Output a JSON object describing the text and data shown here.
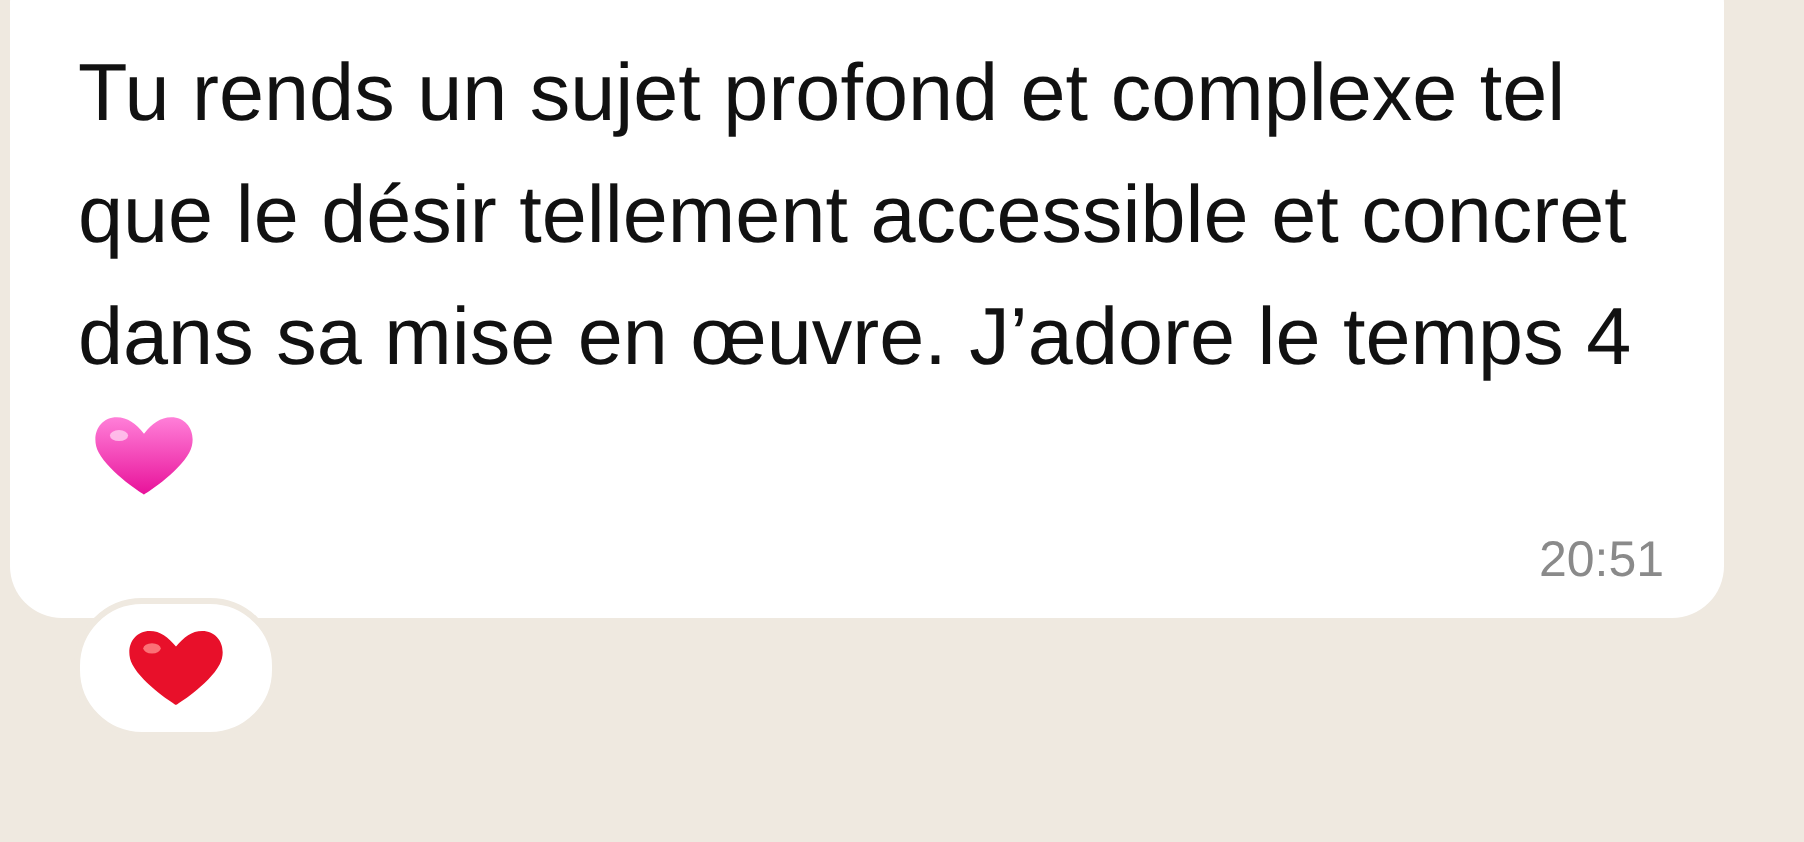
{
  "message": {
    "text": "Tu rends un sujet profond et complexe tel que le désir tellement accessible et concret dans sa mise en œuvre. J’adore le temps 4",
    "time": "20:51"
  }
}
